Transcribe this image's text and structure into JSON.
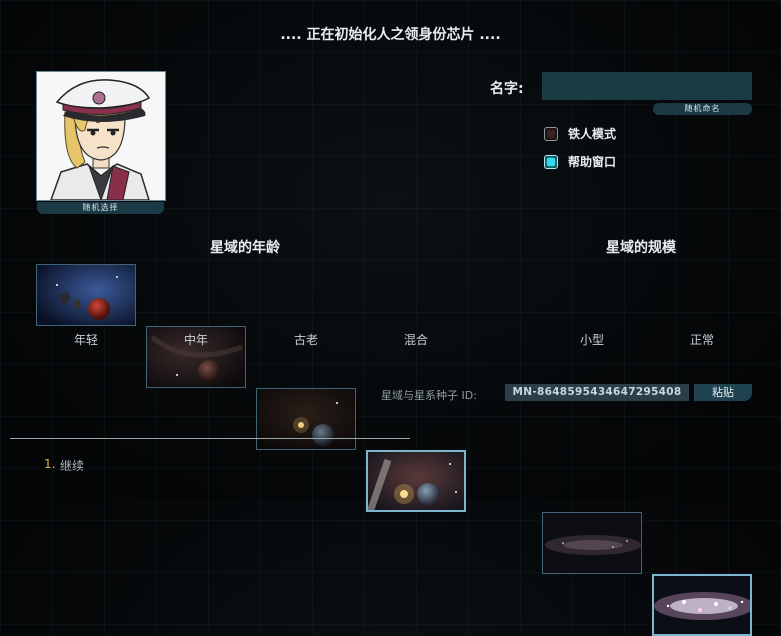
{
  "header": {
    "title": ".... 正在初始化人之领身份芯片 ...."
  },
  "portrait": {
    "random_select": "随机选择"
  },
  "name": {
    "label": "名字:",
    "value": "",
    "placeholder": "",
    "random_name": "随机命名"
  },
  "options": [
    {
      "label": "铁人模式",
      "checked": false
    },
    {
      "label": "帮助窗口",
      "checked": true
    }
  ],
  "age": {
    "title": "星域的年龄",
    "items": [
      {
        "label": "年轻",
        "selected": false
      },
      {
        "label": "中年",
        "selected": false
      },
      {
        "label": "古老",
        "selected": false
      },
      {
        "label": "混合",
        "selected": true
      }
    ]
  },
  "size": {
    "title": "星域的规模",
    "items": [
      {
        "label": "小型",
        "selected": false
      },
      {
        "label": "正常",
        "selected": true
      }
    ]
  },
  "seed": {
    "label": "星域与星系种子 ID:",
    "value": "MN-8648595434647295408",
    "paste": "粘贴"
  },
  "footer": {
    "continue_number": "1.",
    "continue_label": "继续"
  },
  "colors": {
    "accent": "#1b3a45",
    "highlight": "#35d8ee",
    "hotkey": "#e3b23c"
  }
}
